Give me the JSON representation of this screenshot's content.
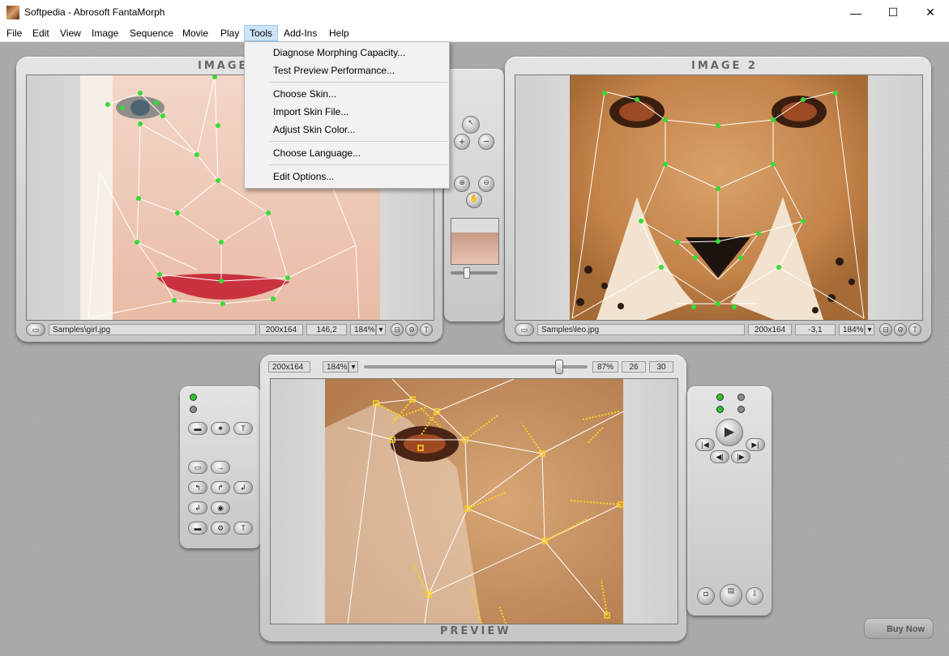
{
  "window": {
    "title": "Softpedia - Abrosoft FantaMorph",
    "minimize": "—",
    "maximize": "☐",
    "close": "✕"
  },
  "menu": [
    "File",
    "Edit",
    "View",
    "Image",
    "Sequence",
    "Movie",
    "Play",
    "Tools",
    "Add-Ins",
    "Help"
  ],
  "tools_menu": {
    "items": [
      "Diagnose Morphing Capacity...",
      "Test Preview Performance...",
      "Choose Skin...",
      "Import Skin File...",
      "Adjust Skin Color...",
      "Choose Language...",
      "Edit Options..."
    ]
  },
  "image1": {
    "title": "IMAGE 1",
    "path": "Samples\\girl.jpg",
    "size": "200x164",
    "coords": "146,2",
    "zoom": "184%"
  },
  "image2": {
    "title": "IMAGE 2",
    "path": "Samples\\leo.jpg",
    "size": "200x164",
    "coords": "-3,1",
    "zoom": "184%"
  },
  "preview": {
    "title": "PREVIEW",
    "size": "200x164",
    "zoom": "184%",
    "percent": "87%",
    "frame": "26",
    "total_frames": "30",
    "slider_fraction": 0.87
  },
  "buy_now": "Buy Now",
  "colors": {
    "menu_highlight": "#cce4f7",
    "mesh_point": "#33dd33",
    "preview_point": "#ffd21e"
  }
}
